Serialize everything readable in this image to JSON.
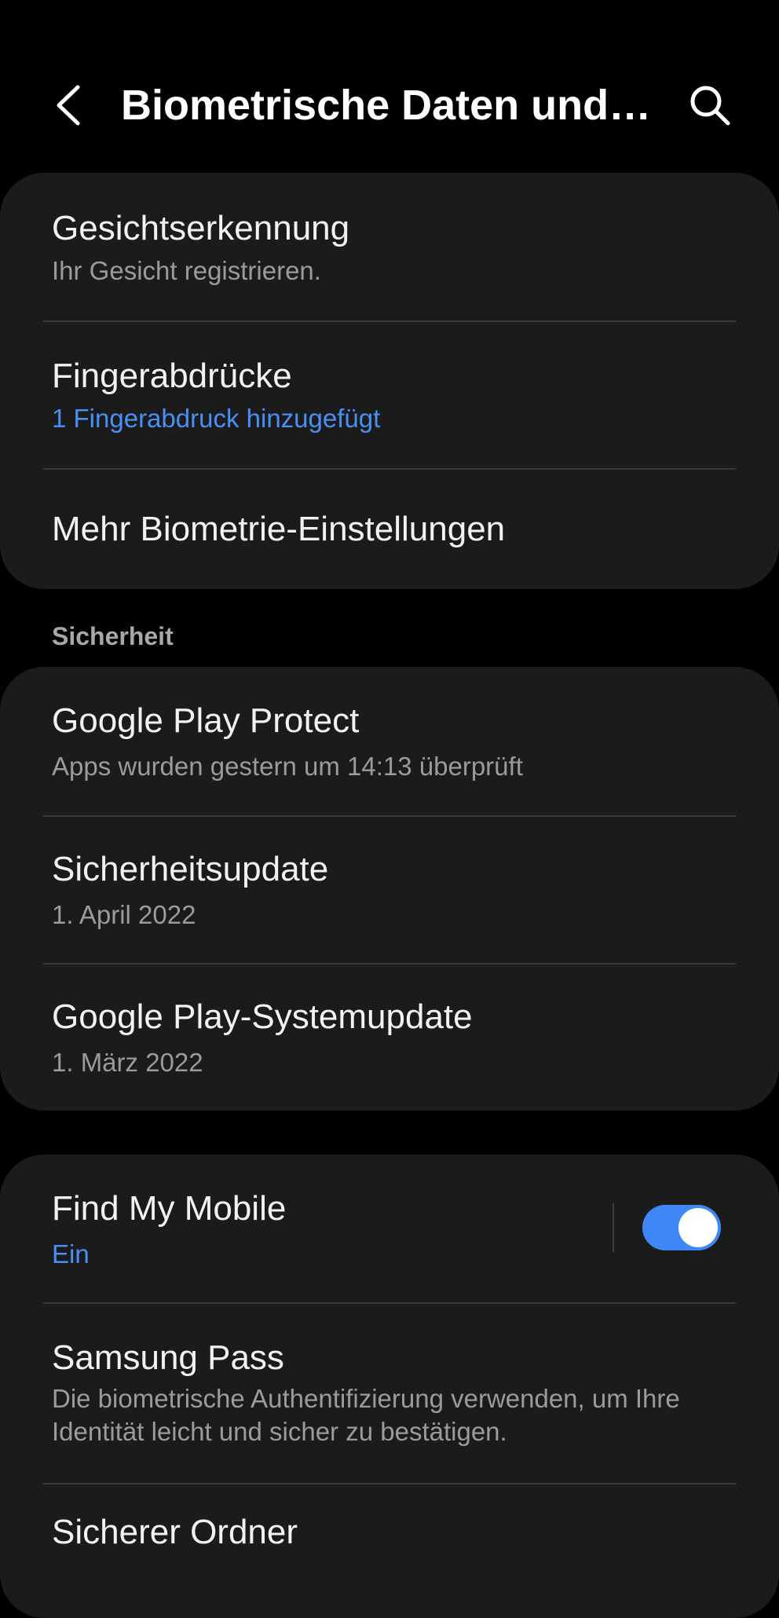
{
  "header": {
    "title": "Biometrische Daten und…",
    "back_icon": "chevron-left-icon",
    "search_icon": "search-icon"
  },
  "biometrics": {
    "items": [
      {
        "title": "Gesichtserkennung",
        "subtitle": "Ihr Gesicht registrieren."
      },
      {
        "title": "Fingerabdrücke",
        "subtitle": "1 Fingerabdruck hinzugefügt"
      },
      {
        "title": "Mehr Biometrie-Einstellungen"
      }
    ]
  },
  "security": {
    "label": "Sicherheit",
    "items": [
      {
        "title": "Google Play Protect",
        "subtitle": "Apps wurden gestern um 14:13 überprüft"
      },
      {
        "title": "Sicherheitsupdate",
        "subtitle": "1. April 2022"
      },
      {
        "title": "Google Play-Systemupdate",
        "subtitle": "1. März 2022"
      }
    ]
  },
  "other": {
    "items": [
      {
        "title": "Find My Mobile",
        "subtitle": "Ein",
        "toggle_on": true
      },
      {
        "title": "Samsung Pass",
        "subtitle": "Die biometrische Authentifizierung verwenden, um Ihre Identität leicht und sicher zu bestätigen."
      },
      {
        "title": "Sicherer Ordner"
      }
    ]
  },
  "colors": {
    "background": "#000000",
    "card": "#1b1b1b",
    "accent": "#4a8ff5",
    "toggle": "#3f87f6"
  }
}
